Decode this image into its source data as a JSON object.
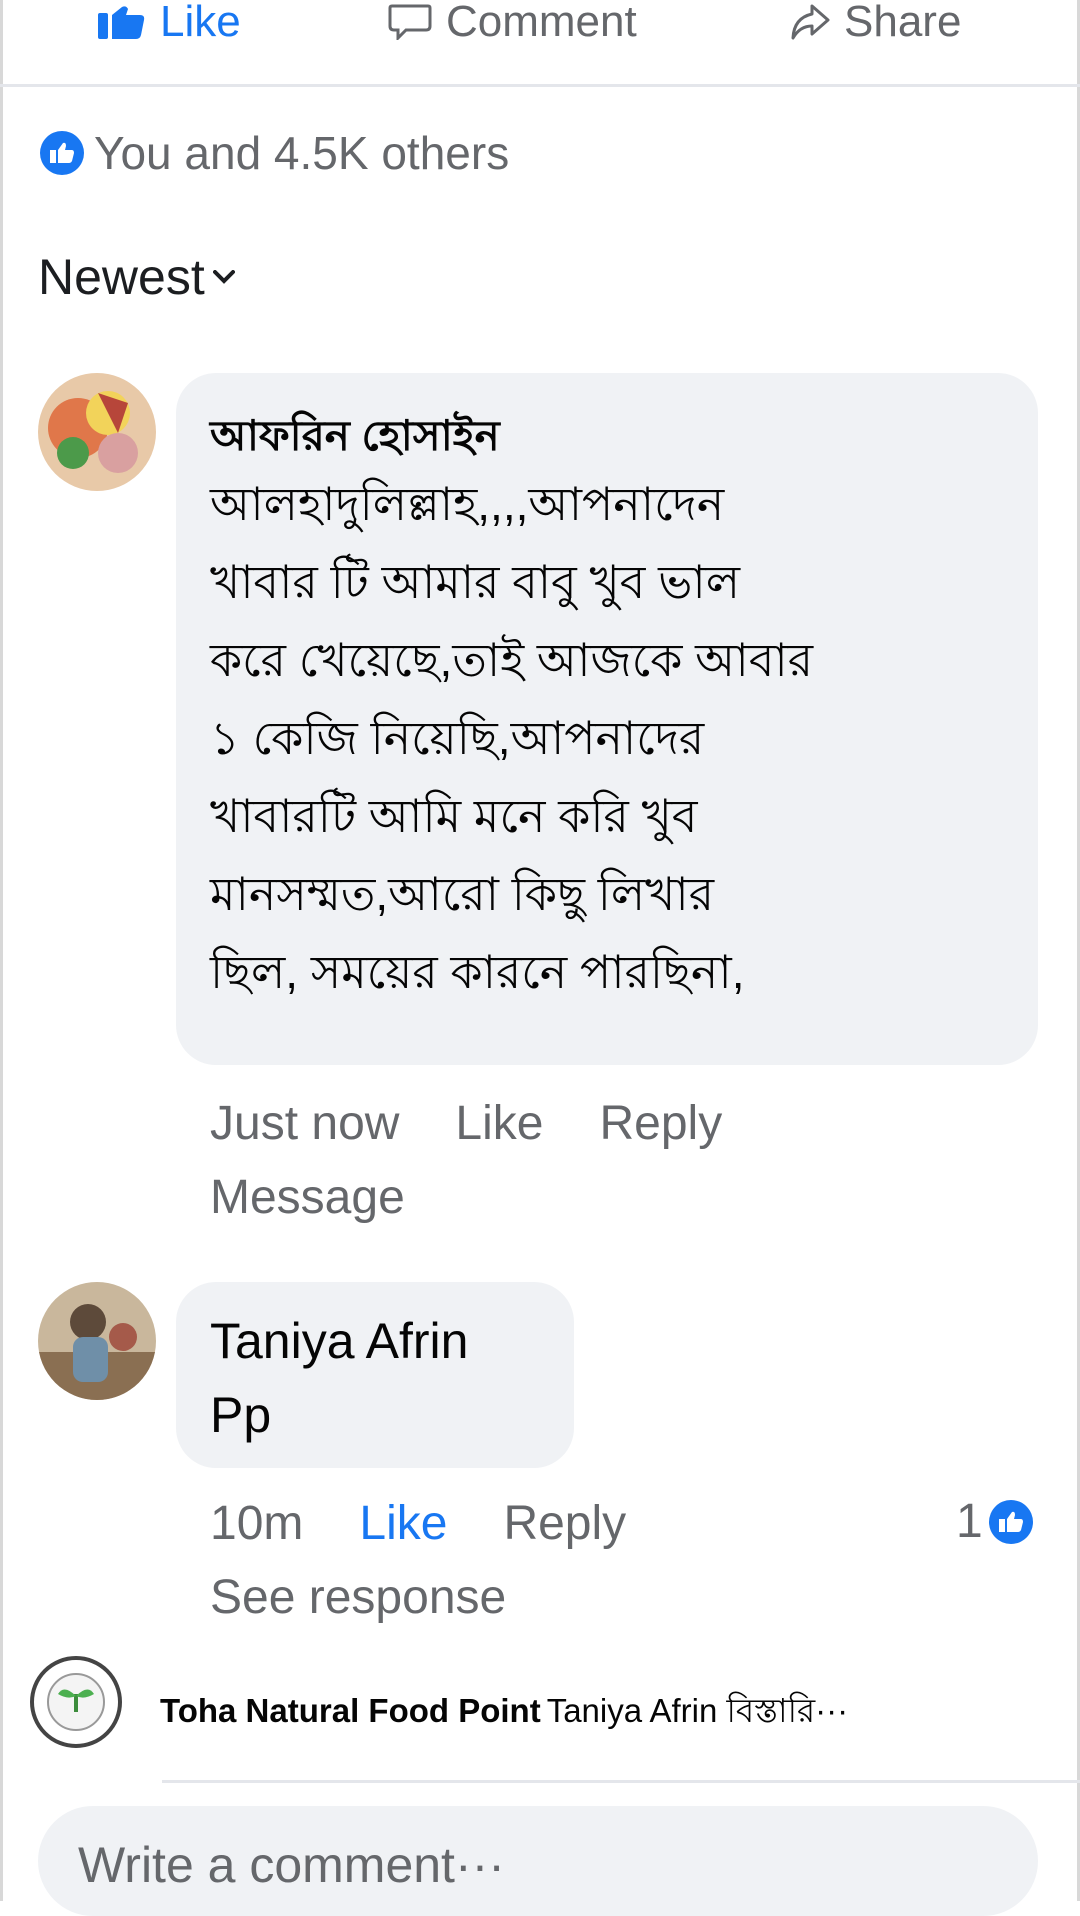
{
  "action_bar": {
    "like_label": "Like",
    "comment_label": "Comment",
    "share_label": "Share"
  },
  "reactions": {
    "summary": "You and 4.5K others"
  },
  "sort": {
    "label": "Newest"
  },
  "comments": [
    {
      "author": "আফরিন হোসাইন",
      "lines": [
        "আলহাদুলিল্লাহ,,,,আপনাদেন",
        "খাবার টি আমার বাবু খুব ভাল",
        "করে খেয়েছে,তাই আজকে আবার",
        "১ কেজি নিয়েছি,আপনাদের",
        "খাবারটি আমি মনে করি খুব",
        "মানসম্মত,আরো কিছু লিখার",
        "ছিল, সময়ের কারনে পারছিনা,"
      ],
      "time": "Just now",
      "like_label": "Like",
      "reply_label": "Reply",
      "extra_label": "Message"
    },
    {
      "author": "Taniya Afrin",
      "text": "Pp",
      "time": "10m",
      "like_label": "Like",
      "reply_label": "Reply",
      "reaction_count": "1",
      "extra_label": "See response"
    }
  ],
  "page_reply": {
    "page_name": "Toha Natural Food Point",
    "text": "Taniya Afrin বিস্তারি···"
  },
  "composer": {
    "placeholder": "Write a comment···"
  },
  "colors": {
    "accent": "#1877f2",
    "muted_text": "#65676b",
    "bubble": "#f0f2f5"
  }
}
